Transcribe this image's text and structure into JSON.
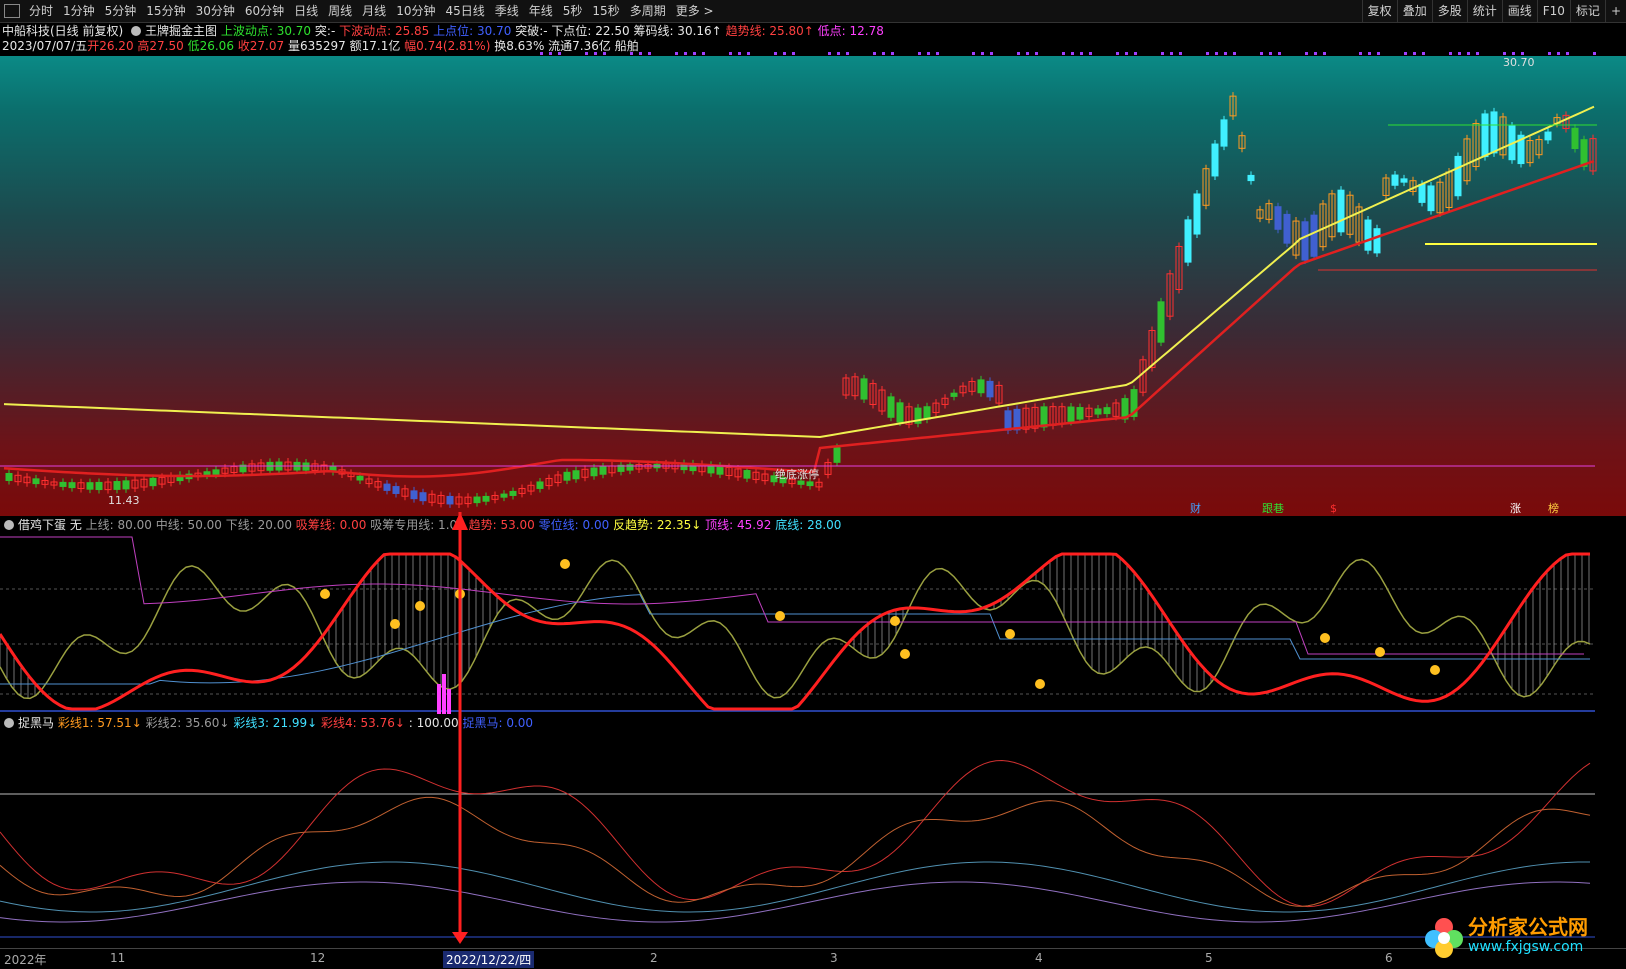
{
  "toolbar": {
    "left_items": [
      "分时",
      "1分钟",
      "5分钟",
      "15分钟",
      "30分钟",
      "60分钟",
      "日线",
      "周线",
      "月线",
      "10分钟",
      "45日线",
      "季线",
      "年线",
      "5秒",
      "15秒",
      "多周期",
      "更多 >"
    ],
    "right_items": [
      "复权",
      "叠加",
      "多股",
      "统计",
      "画线",
      "F10",
      "标记",
      "+"
    ]
  },
  "info1": {
    "stock": "中船科技(日线 前复权)",
    "main_indicator": "王牌掘金主图",
    "upper_label": "上波动点: 30.70",
    "break1": "突:-",
    "lower_label": "下波动点: 25.85",
    "upper_dot": "上点位: 30.70",
    "break2": "突破:-",
    "lower_dot": "下点位: 22.50",
    "chip": "筹码线: 30.16↑",
    "trend": "趋势线: 25.80↑",
    "low": "低点: 12.78"
  },
  "info2": {
    "date": "2023/07/07/五",
    "open": "开26.20",
    "high": "高27.50",
    "lowv": "低26.06",
    "close": "收27.07",
    "vol": "量635297",
    "amount": "额17.1亿",
    "change": "幅0.74(2.81%)",
    "turnover": "换8.63%",
    "float": "流通7.36亿",
    "sector": "船舶"
  },
  "main_chart": {
    "price_high_label": "30.70",
    "price_low_label": "11.43",
    "annotation": "绝底涨停",
    "event_tags": [
      "财",
      "跟巷",
      "$",
      "涨",
      "榜"
    ]
  },
  "ind1": {
    "name": "借鸡下蛋 无",
    "upper": "上线: 80.00",
    "middle": "中线: 50.00",
    "lower": "下线: 20.00",
    "absorb": "吸筹线: 0.00",
    "absorb_special": "吸筹专用线: 1.00",
    "trend": "趋势: 53.00",
    "zero": "零位线: 0.00",
    "reverse": "反趋势: 22.35↓",
    "top": "顶线: 45.92",
    "bottom": "底线: 28.00"
  },
  "ind2": {
    "name": "捉黑马",
    "c1": "彩线1: 57.51↓",
    "c2": "彩线2: 35.60↓",
    "c3": "彩线3: 21.99↓",
    "c4": "彩线4: 53.76↓",
    "c5": ": 100.00",
    "horse": "捉黑马: 0.00"
  },
  "date_axis": {
    "year": "2022年",
    "labels": [
      "11",
      "12",
      "2",
      "3",
      "4",
      "5",
      "6"
    ],
    "cursor": "2022/12/22/四"
  },
  "logo": {
    "title": "分析家公式网",
    "url": "www.fxjgsw.com"
  },
  "colors": {
    "up": "#ff3030",
    "down": "#30ff30",
    "ma_yellow": "#f0f050",
    "ma_red": "#e02020",
    "cyan": "#40f0ff",
    "orange": "#ff9a20",
    "blue": "#4060d0"
  }
}
